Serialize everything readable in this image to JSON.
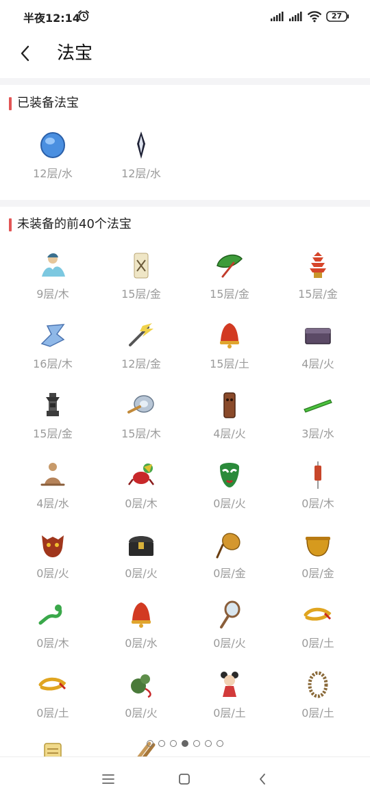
{
  "status_bar": {
    "time": "半夜12:14",
    "battery": "27"
  },
  "header": {
    "title": "法宝"
  },
  "equipped": {
    "section_title": "已装备法宝",
    "items": [
      {
        "label": "12层/水",
        "icon": "blue-gem-icon"
      },
      {
        "label": "12层/水",
        "icon": "dark-crystal-icon"
      }
    ]
  },
  "unequipped": {
    "section_title": "未装备的前40个法宝",
    "items": [
      {
        "label": "9层/木",
        "icon": "spirit-figure-icon"
      },
      {
        "label": "15层/金",
        "icon": "paper-doll-icon"
      },
      {
        "label": "15层/金",
        "icon": "green-fan-icon"
      },
      {
        "label": "15层/金",
        "icon": "pagoda-icon"
      },
      {
        "label": "16层/木",
        "icon": "blue-wings-icon"
      },
      {
        "label": "12层/金",
        "icon": "lightning-pen-icon"
      },
      {
        "label": "15层/土",
        "icon": "red-bell-icon"
      },
      {
        "label": "4层/火",
        "icon": "dark-chest-icon"
      },
      {
        "label": "15层/金",
        "icon": "stone-lantern-icon"
      },
      {
        "label": "15层/木",
        "icon": "silver-disc-icon"
      },
      {
        "label": "4层/火",
        "icon": "wood-totem-icon"
      },
      {
        "label": "3层/水",
        "icon": "jade-ruler-icon"
      },
      {
        "label": "4层/水",
        "icon": "meditating-monk-icon"
      },
      {
        "label": "0层/木",
        "icon": "crab-creature-icon"
      },
      {
        "label": "0层/火",
        "icon": "opera-mask-icon"
      },
      {
        "label": "0层/木",
        "icon": "hanging-tag-icon"
      },
      {
        "label": "0层/火",
        "icon": "demon-mask-icon"
      },
      {
        "label": "0层/火",
        "icon": "treasure-chest-icon"
      },
      {
        "label": "0层/金",
        "icon": "palm-fan-icon"
      },
      {
        "label": "0层/金",
        "icon": "golden-cauldron-icon"
      },
      {
        "label": "0层/木",
        "icon": "green-dragon-icon"
      },
      {
        "label": "0层/水",
        "icon": "red-bell-icon"
      },
      {
        "label": "0层/火",
        "icon": "hand-mirror-icon"
      },
      {
        "label": "0层/土",
        "icon": "yellow-ribbon-icon"
      },
      {
        "label": "0层/土",
        "icon": "yellow-ribbon-icon"
      },
      {
        "label": "0层/火",
        "icon": "gourd-icon"
      },
      {
        "label": "0层/土",
        "icon": "doll-girl-icon"
      },
      {
        "label": "0层/土",
        "icon": "bead-necklace-icon"
      },
      {
        "label": "",
        "icon": "scroll-icon"
      },
      {
        "label": "",
        "icon": "wooden-sticks-icon"
      }
    ]
  },
  "pager": {
    "count": 7,
    "active_index": 3
  },
  "colors": {
    "accent_bar": "#e25656",
    "label_gray": "#9a9a9a"
  }
}
